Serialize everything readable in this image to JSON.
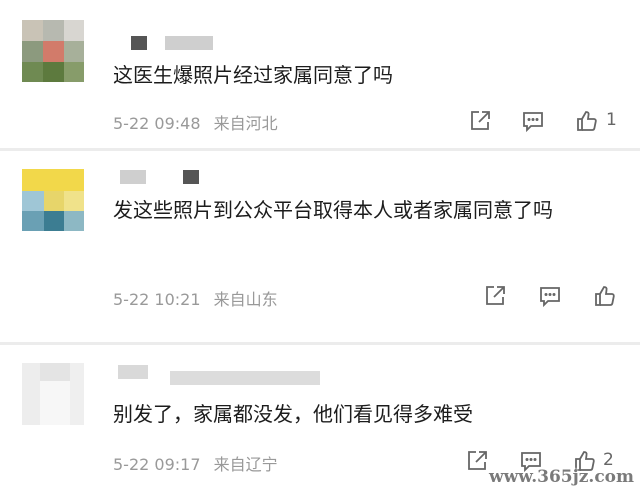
{
  "comments": [
    {
      "text": "这医生爆照片经过家属同意了吗",
      "date": "5-22 09:48",
      "location": "来自河北",
      "likes": "1",
      "icons": [
        "share-icon",
        "comment-icon",
        "thumbs-up-icon"
      ]
    },
    {
      "text": "发这些照片到公众平台取得本人或者家属同意了吗",
      "date": "5-22 10:21",
      "location": "来自山东",
      "likes": "",
      "icons": [
        "share-icon",
        "comment-icon",
        "thumbs-up-icon"
      ]
    },
    {
      "text": "别发了，家属都没发，他们看见得多难受",
      "date": "5-22 09:17",
      "location": "来自辽宁",
      "likes": "2",
      "icons": [
        "share-icon",
        "comment-icon",
        "thumbs-up-icon"
      ]
    }
  ],
  "watermark": "www.365jz.com",
  "colors": {
    "background": "#ececec",
    "card": "#ffffff",
    "text": "#1c1c1c",
    "meta": "#999999",
    "icon": "#666666"
  }
}
